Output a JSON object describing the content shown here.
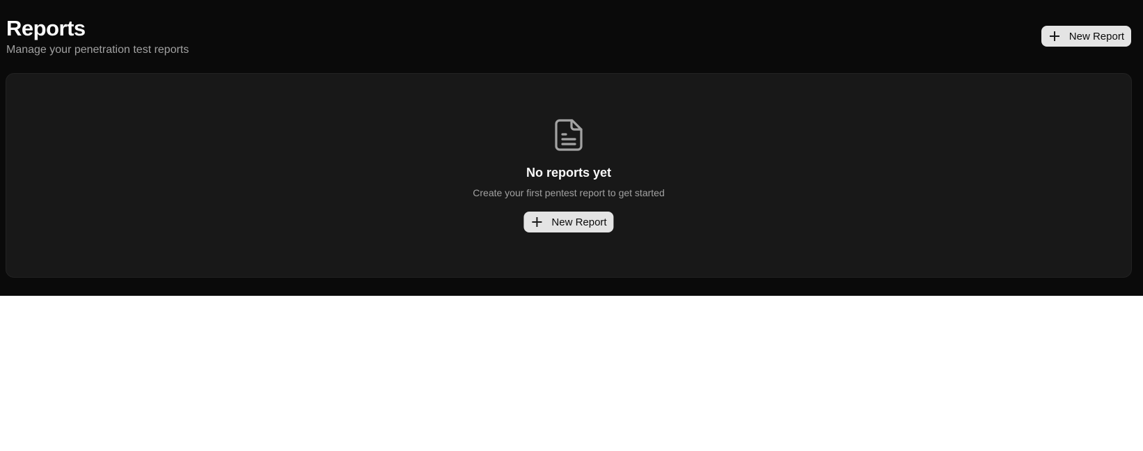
{
  "header": {
    "title": "Reports",
    "subtitle": "Manage your penetration test reports",
    "new_report_label": "New Report"
  },
  "empty_state": {
    "icon": "file-text-icon",
    "title": "No reports yet",
    "description": "Create your first pentest report to get started",
    "new_report_label": "New Report"
  },
  "colors": {
    "background": "#0a0a0a",
    "card": "#181818",
    "button": "#e4e4e4",
    "text_primary": "#fafafa",
    "text_muted": "#a1a1a1"
  }
}
